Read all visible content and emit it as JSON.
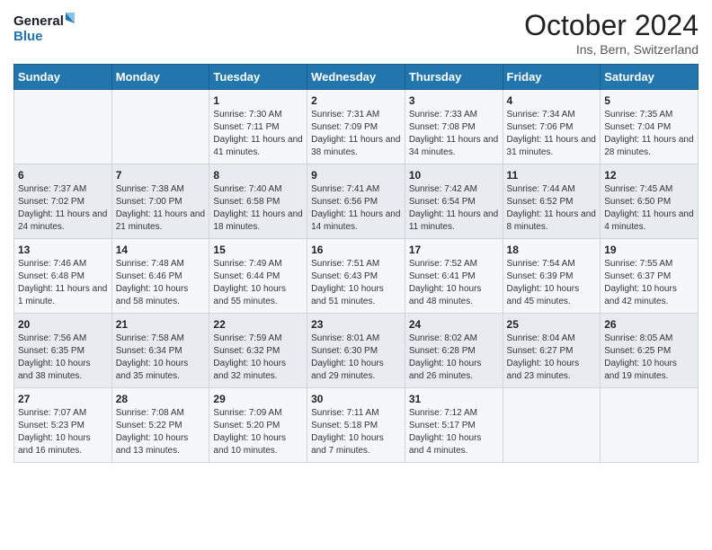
{
  "logo": {
    "line1": "General",
    "line2": "Blue"
  },
  "title": "October 2024",
  "location": "Ins, Bern, Switzerland",
  "weekdays": [
    "Sunday",
    "Monday",
    "Tuesday",
    "Wednesday",
    "Thursday",
    "Friday",
    "Saturday"
  ],
  "weeks": [
    [
      {
        "day": "",
        "sunrise": "",
        "sunset": "",
        "daylight": ""
      },
      {
        "day": "",
        "sunrise": "",
        "sunset": "",
        "daylight": ""
      },
      {
        "day": "1",
        "sunrise": "Sunrise: 7:30 AM",
        "sunset": "Sunset: 7:11 PM",
        "daylight": "Daylight: 11 hours and 41 minutes."
      },
      {
        "day": "2",
        "sunrise": "Sunrise: 7:31 AM",
        "sunset": "Sunset: 7:09 PM",
        "daylight": "Daylight: 11 hours and 38 minutes."
      },
      {
        "day": "3",
        "sunrise": "Sunrise: 7:33 AM",
        "sunset": "Sunset: 7:08 PM",
        "daylight": "Daylight: 11 hours and 34 minutes."
      },
      {
        "day": "4",
        "sunrise": "Sunrise: 7:34 AM",
        "sunset": "Sunset: 7:06 PM",
        "daylight": "Daylight: 11 hours and 31 minutes."
      },
      {
        "day": "5",
        "sunrise": "Sunrise: 7:35 AM",
        "sunset": "Sunset: 7:04 PM",
        "daylight": "Daylight: 11 hours and 28 minutes."
      }
    ],
    [
      {
        "day": "6",
        "sunrise": "Sunrise: 7:37 AM",
        "sunset": "Sunset: 7:02 PM",
        "daylight": "Daylight: 11 hours and 24 minutes."
      },
      {
        "day": "7",
        "sunrise": "Sunrise: 7:38 AM",
        "sunset": "Sunset: 7:00 PM",
        "daylight": "Daylight: 11 hours and 21 minutes."
      },
      {
        "day": "8",
        "sunrise": "Sunrise: 7:40 AM",
        "sunset": "Sunset: 6:58 PM",
        "daylight": "Daylight: 11 hours and 18 minutes."
      },
      {
        "day": "9",
        "sunrise": "Sunrise: 7:41 AM",
        "sunset": "Sunset: 6:56 PM",
        "daylight": "Daylight: 11 hours and 14 minutes."
      },
      {
        "day": "10",
        "sunrise": "Sunrise: 7:42 AM",
        "sunset": "Sunset: 6:54 PM",
        "daylight": "Daylight: 11 hours and 11 minutes."
      },
      {
        "day": "11",
        "sunrise": "Sunrise: 7:44 AM",
        "sunset": "Sunset: 6:52 PM",
        "daylight": "Daylight: 11 hours and 8 minutes."
      },
      {
        "day": "12",
        "sunrise": "Sunrise: 7:45 AM",
        "sunset": "Sunset: 6:50 PM",
        "daylight": "Daylight: 11 hours and 4 minutes."
      }
    ],
    [
      {
        "day": "13",
        "sunrise": "Sunrise: 7:46 AM",
        "sunset": "Sunset: 6:48 PM",
        "daylight": "Daylight: 11 hours and 1 minute."
      },
      {
        "day": "14",
        "sunrise": "Sunrise: 7:48 AM",
        "sunset": "Sunset: 6:46 PM",
        "daylight": "Daylight: 10 hours and 58 minutes."
      },
      {
        "day": "15",
        "sunrise": "Sunrise: 7:49 AM",
        "sunset": "Sunset: 6:44 PM",
        "daylight": "Daylight: 10 hours and 55 minutes."
      },
      {
        "day": "16",
        "sunrise": "Sunrise: 7:51 AM",
        "sunset": "Sunset: 6:43 PM",
        "daylight": "Daylight: 10 hours and 51 minutes."
      },
      {
        "day": "17",
        "sunrise": "Sunrise: 7:52 AM",
        "sunset": "Sunset: 6:41 PM",
        "daylight": "Daylight: 10 hours and 48 minutes."
      },
      {
        "day": "18",
        "sunrise": "Sunrise: 7:54 AM",
        "sunset": "Sunset: 6:39 PM",
        "daylight": "Daylight: 10 hours and 45 minutes."
      },
      {
        "day": "19",
        "sunrise": "Sunrise: 7:55 AM",
        "sunset": "Sunset: 6:37 PM",
        "daylight": "Daylight: 10 hours and 42 minutes."
      }
    ],
    [
      {
        "day": "20",
        "sunrise": "Sunrise: 7:56 AM",
        "sunset": "Sunset: 6:35 PM",
        "daylight": "Daylight: 10 hours and 38 minutes."
      },
      {
        "day": "21",
        "sunrise": "Sunrise: 7:58 AM",
        "sunset": "Sunset: 6:34 PM",
        "daylight": "Daylight: 10 hours and 35 minutes."
      },
      {
        "day": "22",
        "sunrise": "Sunrise: 7:59 AM",
        "sunset": "Sunset: 6:32 PM",
        "daylight": "Daylight: 10 hours and 32 minutes."
      },
      {
        "day": "23",
        "sunrise": "Sunrise: 8:01 AM",
        "sunset": "Sunset: 6:30 PM",
        "daylight": "Daylight: 10 hours and 29 minutes."
      },
      {
        "day": "24",
        "sunrise": "Sunrise: 8:02 AM",
        "sunset": "Sunset: 6:28 PM",
        "daylight": "Daylight: 10 hours and 26 minutes."
      },
      {
        "day": "25",
        "sunrise": "Sunrise: 8:04 AM",
        "sunset": "Sunset: 6:27 PM",
        "daylight": "Daylight: 10 hours and 23 minutes."
      },
      {
        "day": "26",
        "sunrise": "Sunrise: 8:05 AM",
        "sunset": "Sunset: 6:25 PM",
        "daylight": "Daylight: 10 hours and 19 minutes."
      }
    ],
    [
      {
        "day": "27",
        "sunrise": "Sunrise: 7:07 AM",
        "sunset": "Sunset: 5:23 PM",
        "daylight": "Daylight: 10 hours and 16 minutes."
      },
      {
        "day": "28",
        "sunrise": "Sunrise: 7:08 AM",
        "sunset": "Sunset: 5:22 PM",
        "daylight": "Daylight: 10 hours and 13 minutes."
      },
      {
        "day": "29",
        "sunrise": "Sunrise: 7:09 AM",
        "sunset": "Sunset: 5:20 PM",
        "daylight": "Daylight: 10 hours and 10 minutes."
      },
      {
        "day": "30",
        "sunrise": "Sunrise: 7:11 AM",
        "sunset": "Sunset: 5:18 PM",
        "daylight": "Daylight: 10 hours and 7 minutes."
      },
      {
        "day": "31",
        "sunrise": "Sunrise: 7:12 AM",
        "sunset": "Sunset: 5:17 PM",
        "daylight": "Daylight: 10 hours and 4 minutes."
      },
      {
        "day": "",
        "sunrise": "",
        "sunset": "",
        "daylight": ""
      },
      {
        "day": "",
        "sunrise": "",
        "sunset": "",
        "daylight": ""
      }
    ]
  ]
}
